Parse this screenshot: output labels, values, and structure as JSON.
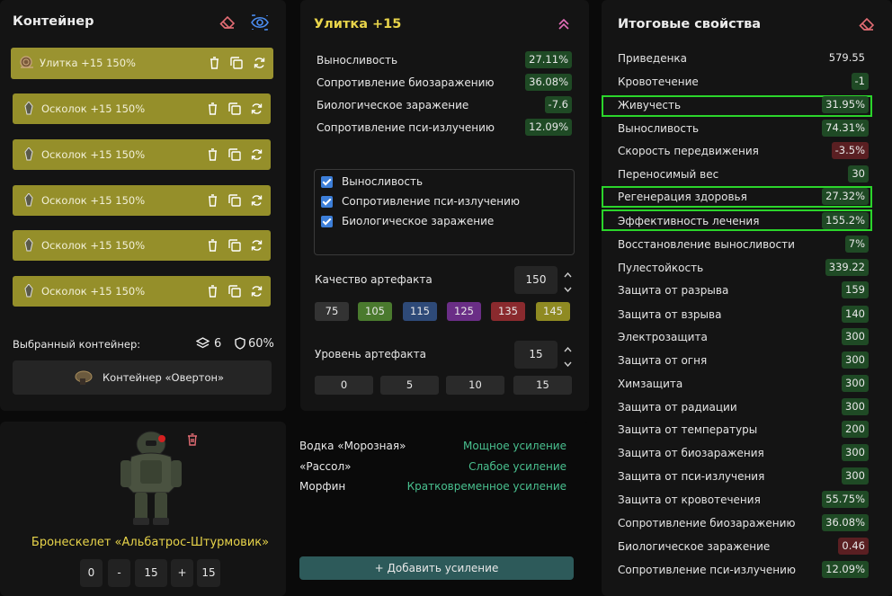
{
  "container_panel": {
    "title": "Контейнер",
    "items": [
      {
        "label": "Улитка +15 150%"
      },
      {
        "label": "Осколок +15 150%"
      },
      {
        "label": "Осколок +15 150%"
      },
      {
        "label": "Осколок +15 150%"
      },
      {
        "label": "Осколок +15 150%"
      },
      {
        "label": "Осколок +15 150%"
      }
    ],
    "selected_label": "Выбранный контейнер:",
    "slots_count": "6",
    "protection": "60%",
    "container_name": "Контейнер «Овертон»"
  },
  "artifact_panel": {
    "title": "Улитка +15",
    "stats": [
      {
        "name": "Выносливость",
        "value": "27.11%",
        "tone": "green"
      },
      {
        "name": "Сопротивление биозаражению",
        "value": "36.08%",
        "tone": "green"
      },
      {
        "name": "Биологическое заражение",
        "value": "-7.6",
        "tone": "green"
      },
      {
        "name": "Сопротивление пси-излучению",
        "value": "12.09%",
        "tone": "green"
      }
    ],
    "checkboxes": [
      {
        "label": "Выносливость",
        "checked": true
      },
      {
        "label": "Сопротивление пси-излучению",
        "checked": true
      },
      {
        "label": "Биологическое заражение",
        "checked": true
      }
    ],
    "quality_label": "Качество артефакта",
    "quality_value": "150",
    "quality_options": [
      {
        "label": "75",
        "color": "#333333"
      },
      {
        "label": "105",
        "color": "#4a7a2e"
      },
      {
        "label": "115",
        "color": "#2e4a78"
      },
      {
        "label": "125",
        "color": "#6a2e86"
      },
      {
        "label": "135",
        "color": "#8a2a2e"
      },
      {
        "label": "145",
        "color": "#8f8a22"
      }
    ],
    "level_label": "Уровень артефакта",
    "level_value": "15",
    "level_options": [
      "0",
      "5",
      "10",
      "15"
    ]
  },
  "armor_panel": {
    "name": "Бронескелет «Альбатрос-Штурмовик»",
    "stepper": {
      "min": "0",
      "minus": "-",
      "value": "15",
      "plus": "+",
      "max": "15"
    }
  },
  "boosts_panel": {
    "items": [
      {
        "name": "Водка «Морозная»",
        "effect": "Мощное усиление"
      },
      {
        "name": "«Рассол»",
        "effect": "Слабое усиление"
      },
      {
        "name": "Морфин",
        "effect": "Кратковременное усиление"
      }
    ],
    "add_label": "+ Добавить усиление"
  },
  "totals_panel": {
    "title": "Итоговые свойства",
    "stats": [
      {
        "name": "Приведенка",
        "value": "579.55",
        "tone": "plain"
      },
      {
        "name": "Кровотечение",
        "value": "-1",
        "tone": "green"
      },
      {
        "name": "Живучесть",
        "value": "31.95%",
        "tone": "green",
        "highlight": true
      },
      {
        "name": "Выносливость",
        "value": "74.31%",
        "tone": "green"
      },
      {
        "name": "Скорость передвижения",
        "value": "-3.5%",
        "tone": "red"
      },
      {
        "name": "Переносимый вес",
        "value": "30",
        "tone": "green"
      },
      {
        "name": "Регенерация здоровья",
        "value": "27.32%",
        "tone": "green",
        "highlight": true
      },
      {
        "name": "Эффективность лечения",
        "value": "155.2%",
        "tone": "green",
        "highlight": true
      },
      {
        "name": "Восстановление выносливости",
        "value": "7%",
        "tone": "green"
      },
      {
        "name": "Пулестойкость",
        "value": "339.22",
        "tone": "green"
      },
      {
        "name": "Защита от разрыва",
        "value": "159",
        "tone": "green"
      },
      {
        "name": "Защита от взрыва",
        "value": "140",
        "tone": "green"
      },
      {
        "name": "Электрозащита",
        "value": "300",
        "tone": "green"
      },
      {
        "name": "Защита от огня",
        "value": "300",
        "tone": "green"
      },
      {
        "name": "Химзащита",
        "value": "300",
        "tone": "green"
      },
      {
        "name": "Защита от радиации",
        "value": "300",
        "tone": "green"
      },
      {
        "name": "Защита от температуры",
        "value": "200",
        "tone": "green"
      },
      {
        "name": "Защита от биозаражения",
        "value": "300",
        "tone": "green"
      },
      {
        "name": "Защита от пси-излучения",
        "value": "300",
        "tone": "green"
      },
      {
        "name": "Защита от кровотечения",
        "value": "55.75%",
        "tone": "green"
      },
      {
        "name": "Сопротивление биозаражению",
        "value": "36.08%",
        "tone": "green"
      },
      {
        "name": "Биологическое заражение",
        "value": "0.46",
        "tone": "red"
      },
      {
        "name": "Сопротивление пси-излучению",
        "value": "12.09%",
        "tone": "green"
      }
    ]
  },
  "colors": {
    "accent_yellow": "#e8d44a",
    "item_bar": "#958f2a",
    "green_badge": "#1f4a25",
    "red_badge": "#5a1f22",
    "boost_text": "#49c08f",
    "highlight_border": "#2bd52b"
  }
}
